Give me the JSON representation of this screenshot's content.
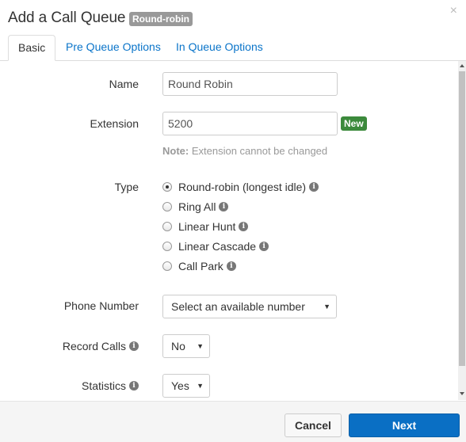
{
  "dialog": {
    "title": "Add a Call Queue",
    "badge": "Round-robin",
    "close_glyph": "×"
  },
  "tabs": [
    {
      "label": "Basic",
      "active": true
    },
    {
      "label": "Pre Queue Options",
      "active": false
    },
    {
      "label": "In Queue Options",
      "active": false
    }
  ],
  "form": {
    "name": {
      "label": "Name",
      "value": "Round Robin"
    },
    "extension": {
      "label": "Extension",
      "value": "5200",
      "badge": "New"
    },
    "note": {
      "prefix": "Note:",
      "text": " Extension cannot be changed"
    },
    "type": {
      "label": "Type",
      "options": [
        {
          "label": "Round-robin (longest idle)",
          "checked": true
        },
        {
          "label": "Ring All",
          "checked": false
        },
        {
          "label": "Linear Hunt",
          "checked": false
        },
        {
          "label": "Linear Cascade",
          "checked": false
        },
        {
          "label": "Call Park",
          "checked": false
        }
      ]
    },
    "phone_number": {
      "label": "Phone Number",
      "value": "Select an available number"
    },
    "record_calls": {
      "label": "Record Calls",
      "value": "No"
    },
    "statistics": {
      "label": "Statistics",
      "value": "Yes"
    }
  },
  "footer": {
    "cancel_label": "Cancel",
    "next_label": "Next"
  },
  "colors": {
    "accent": "#0a6fc4",
    "new_badge": "#3c8a3c",
    "title_badge": "#999999"
  }
}
